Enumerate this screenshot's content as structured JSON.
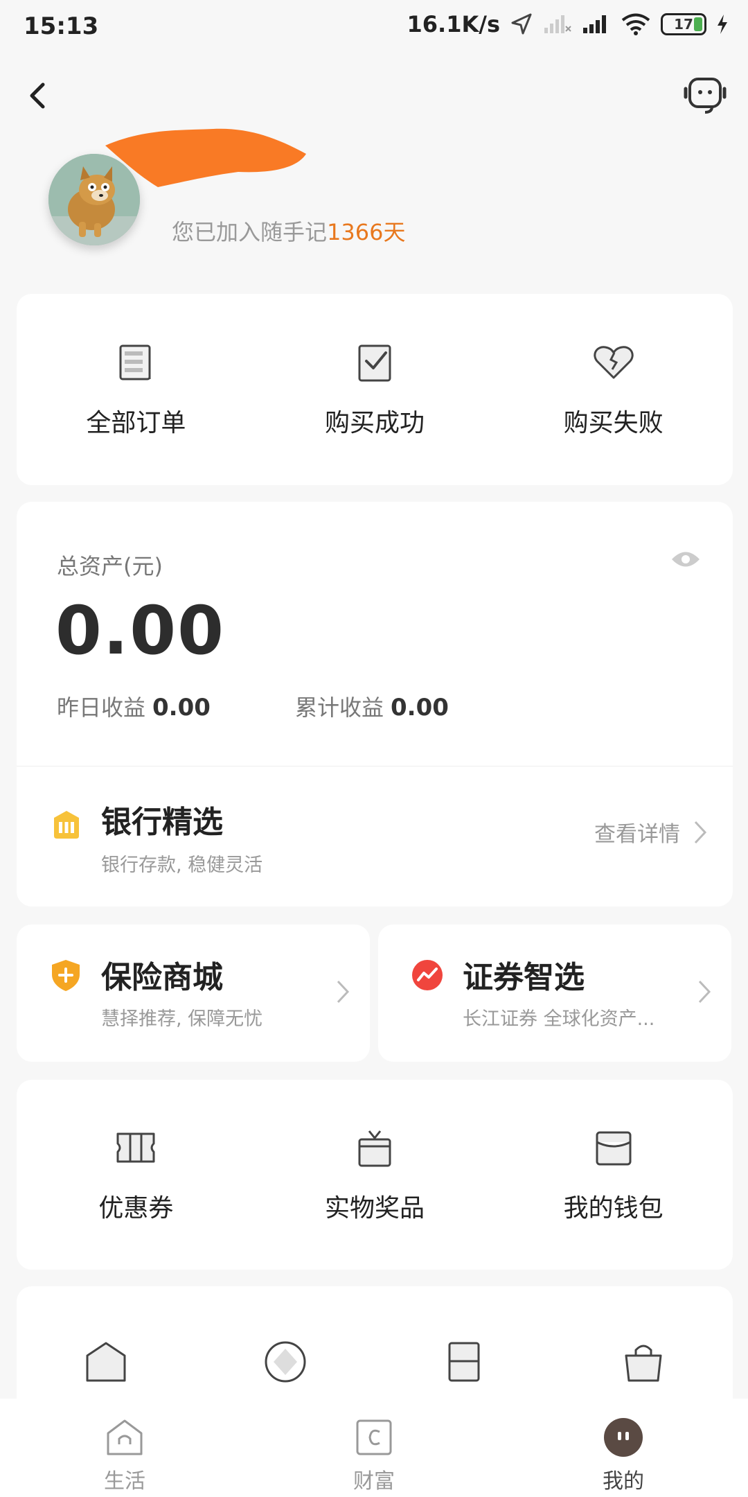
{
  "status_bar": {
    "time": "15:13",
    "speed": "16.1K/s",
    "battery": "17"
  },
  "profile": {
    "joined_prefix": "您已加入随手记",
    "joined_days": "1366天"
  },
  "orders": [
    {
      "label": "全部订单",
      "icon": "orders-list-icon"
    },
    {
      "label": "购买成功",
      "icon": "checklist-icon"
    },
    {
      "label": "购买失败",
      "icon": "broken-heart-icon"
    }
  ],
  "assets": {
    "title": "总资产(元)",
    "total": "0.00",
    "yesterday_label": "昨日收益",
    "yesterday_value": "0.00",
    "cumulative_label": "累计收益",
    "cumulative_value": "0.00"
  },
  "bank": {
    "title": "银行精选",
    "subtitle": "银行存款, 稳健灵活",
    "link": "查看详情"
  },
  "insurance": {
    "title": "保险商城",
    "subtitle": "慧择推荐, 保障无忧"
  },
  "securities": {
    "title": "证券智选",
    "subtitle": "长江证券 全球化资产..."
  },
  "rewards": [
    {
      "label": "优惠券",
      "icon": "coupon-icon"
    },
    {
      "label": "实物奖品",
      "icon": "gift-box-icon"
    },
    {
      "label": "我的钱包",
      "icon": "wallet-icon"
    }
  ],
  "tabs": [
    {
      "label": "生活",
      "icon": "home-tab-icon"
    },
    {
      "label": "财富",
      "icon": "wealth-tab-icon"
    },
    {
      "label": "我的",
      "icon": "profile-tab-icon"
    }
  ],
  "colors": {
    "accent": "#e8781e",
    "bank": "#f7c23a",
    "insurance": "#f5a623",
    "securities": "#f0453d"
  }
}
